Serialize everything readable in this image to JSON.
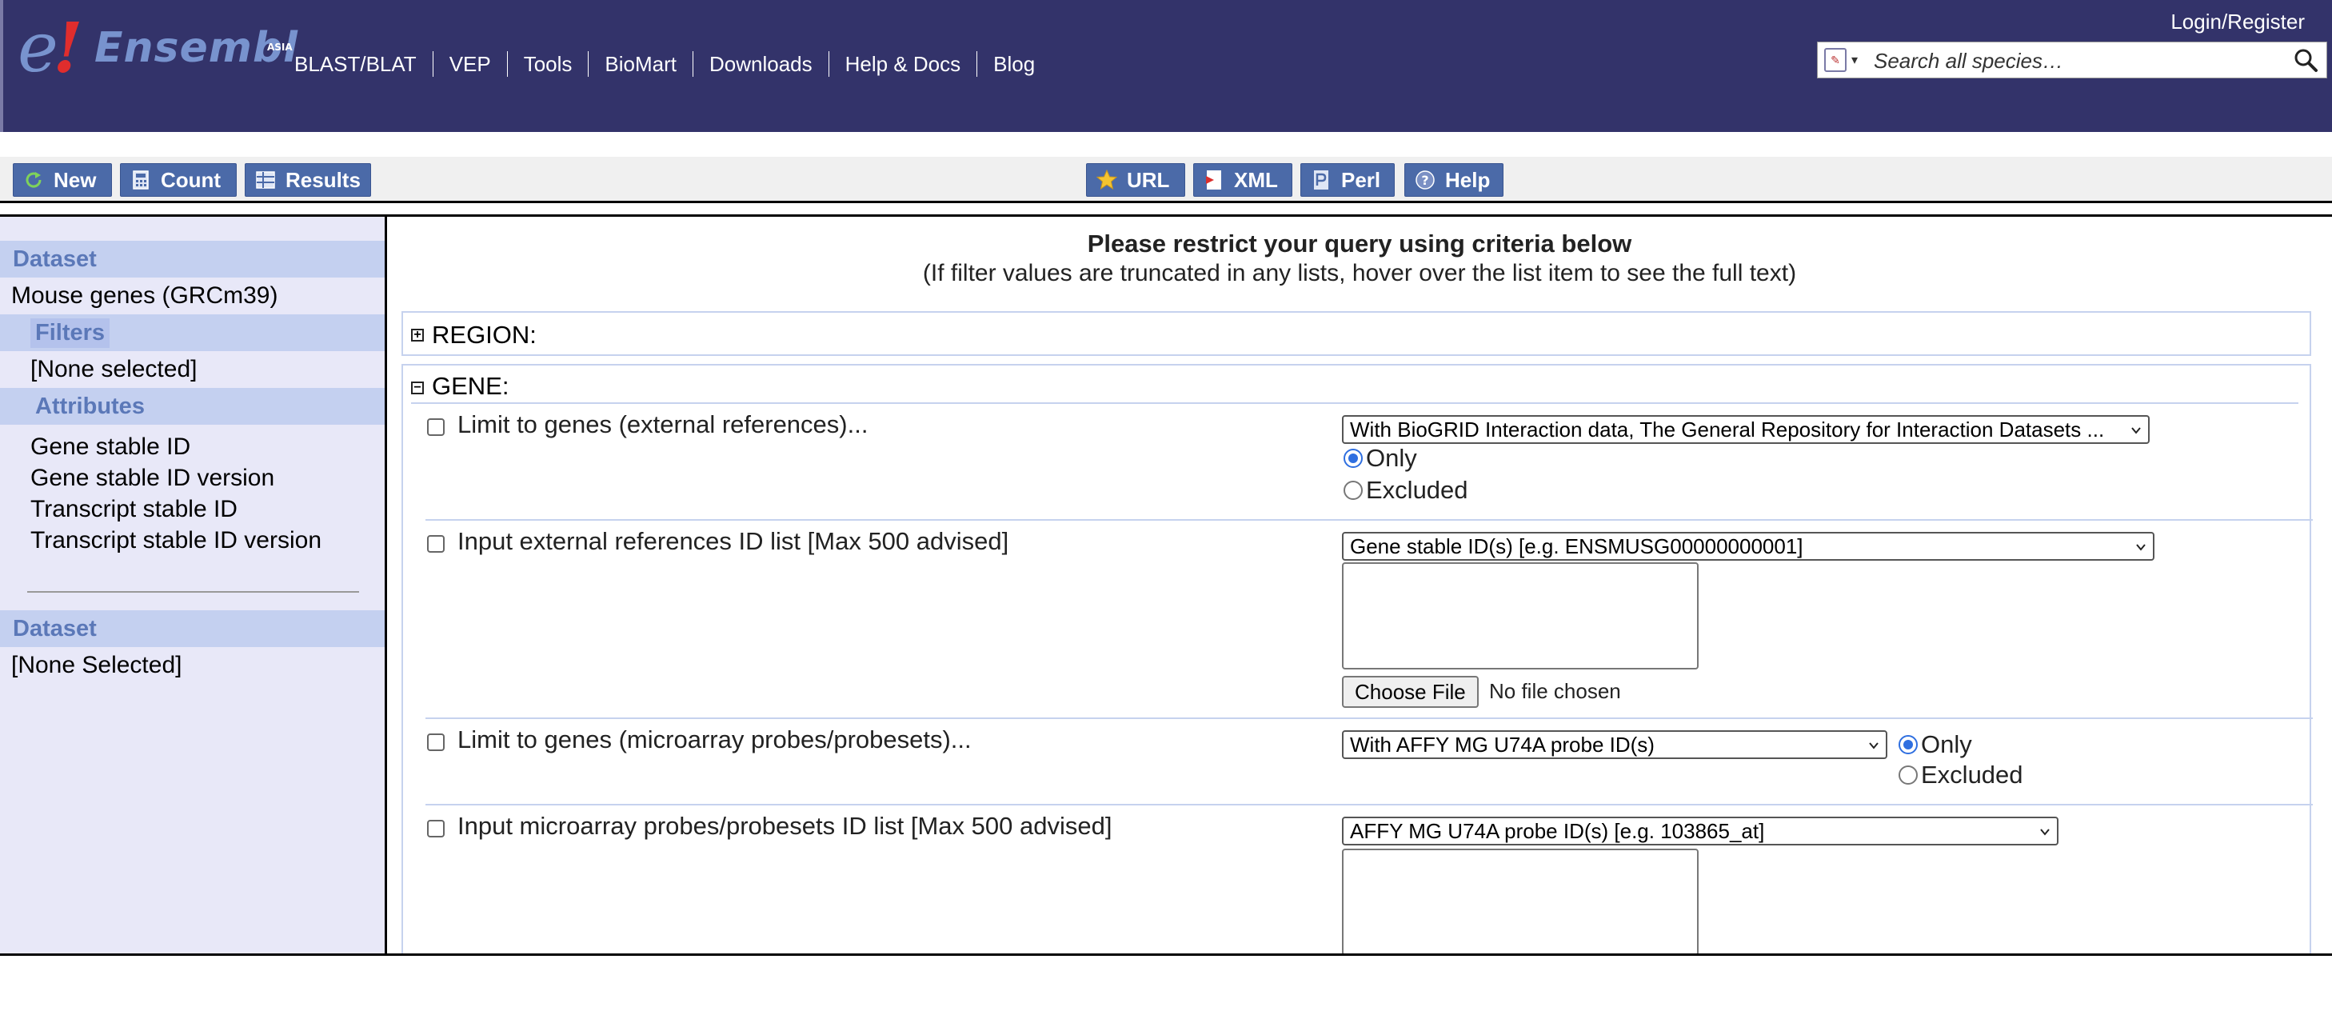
{
  "header": {
    "logo": {
      "e": "e",
      "bang": "!",
      "word": "Ensembl",
      "region": "ASIA"
    },
    "nav": [
      "BLAST/BLAT",
      "VEP",
      "Tools",
      "BioMart",
      "Downloads",
      "Help & Docs",
      "Blog"
    ],
    "login": "Login/Register",
    "search_placeholder": "Search all species…"
  },
  "toolbar": {
    "left": [
      {
        "label": "New",
        "icon": "refresh-icon"
      },
      {
        "label": "Count",
        "icon": "calculator-icon"
      },
      {
        "label": "Results",
        "icon": "table-icon"
      }
    ],
    "center": [
      {
        "label": "URL",
        "icon": "star-icon"
      },
      {
        "label": "XML",
        "icon": "xml-icon"
      },
      {
        "label": "Perl",
        "icon": "perl-icon"
      },
      {
        "label": "Help",
        "icon": "help-icon"
      }
    ]
  },
  "sidebar": {
    "dataset_heading": "Dataset",
    "dataset_name": "Mouse genes (GRCm39)",
    "filters_heading": "Filters",
    "filters_value": "[None selected]",
    "attributes_heading": "Attributes",
    "attributes": [
      "Gene stable ID",
      "Gene stable ID version",
      "Transcript stable ID",
      "Transcript stable ID version"
    ],
    "dataset2_heading": "Dataset",
    "dataset2_value": "[None Selected]"
  },
  "main": {
    "title": "Please restrict your query using criteria below",
    "subtitle": "(If filter values are truncated in any lists, hover over the list item to see the full text)",
    "region_label": "REGION:",
    "gene_label": "GENE:",
    "filters": [
      {
        "label": "Limit to genes (external references)...",
        "select": "With BioGRID Interaction data, The General Repository for Interaction Datasets ...",
        "radio_only": "Only",
        "radio_excluded": "Excluded"
      },
      {
        "label": "Input external references ID list [Max 500 advised]",
        "select": "Gene stable ID(s) [e.g. ENSMUSG00000000001]",
        "file_button": "Choose File",
        "file_status": "No file chosen"
      },
      {
        "label": "Limit to genes (microarray probes/probesets)...",
        "select": "With AFFY MG U74A probe ID(s)",
        "radio_only": "Only",
        "radio_excluded": "Excluded"
      },
      {
        "label": "Input microarray probes/probesets ID list [Max 500 advised]",
        "select": "AFFY MG U74A probe ID(s) [e.g. 103865_at]"
      }
    ]
  }
}
